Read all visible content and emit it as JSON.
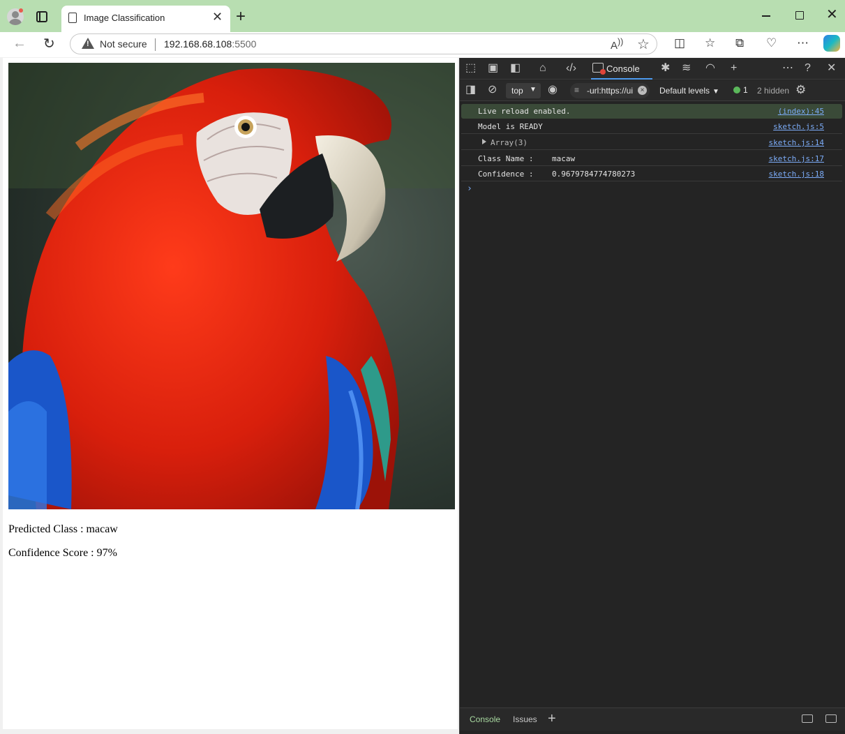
{
  "browser": {
    "tab_title": "Image Classification",
    "security_label": "Not secure",
    "url_host": "192.168.68.108",
    "url_port": ":5500"
  },
  "page": {
    "image_alt": "macaw",
    "predicted_class": "Predicted Class : macaw",
    "confidence_score": "Confidence Score : 97%"
  },
  "devtools": {
    "active_tab": "Console",
    "context": "top",
    "url_filter": "-url:https://ui",
    "levels": "Default levels",
    "issues_count": "1",
    "hidden_count": "2 hidden",
    "messages": [
      {
        "text": "Live reload enabled.",
        "value": "",
        "source": "(index):45"
      },
      {
        "text": "Model is READY",
        "value": "",
        "source": "sketch.js:5"
      },
      {
        "text": "Array(3)",
        "value": "",
        "source": "sketch.js:14"
      },
      {
        "text": "Class Name :",
        "value": "macaw",
        "source": "sketch.js:17"
      },
      {
        "text": "Confidence :",
        "value": "0.9679784774780273",
        "source": "sketch.js:18"
      }
    ],
    "drawer_tabs": [
      "Console",
      "Issues"
    ]
  },
  "colors": {
    "titlebar": "#b8deb1",
    "devtools_bg": "#242424",
    "link": "#7cacf8",
    "macaw_red": "#e4230f",
    "macaw_blue": "#1a56c9"
  }
}
